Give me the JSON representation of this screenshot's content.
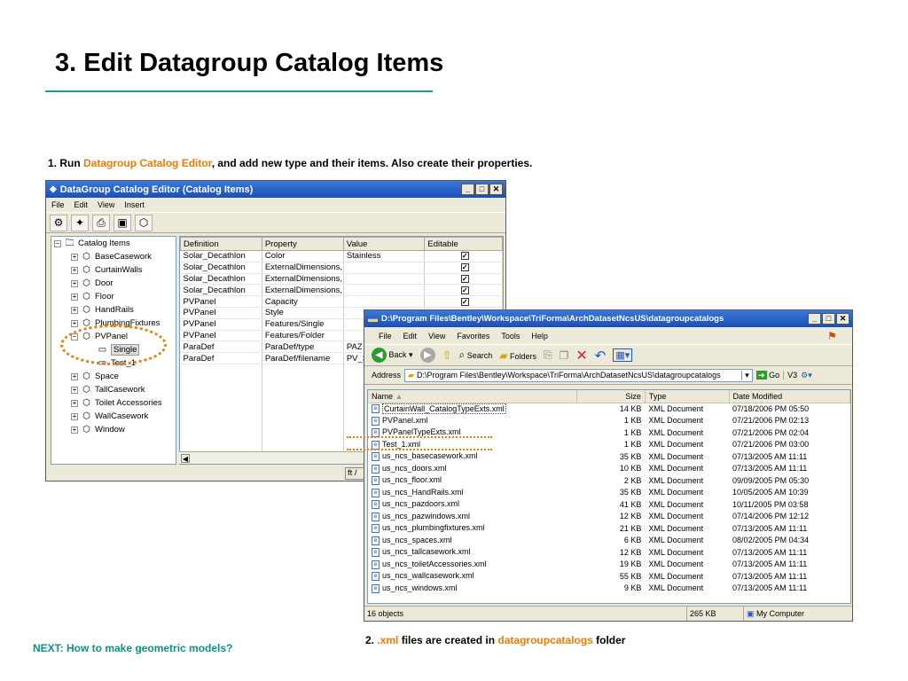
{
  "slide": {
    "title": "3. Edit Datagroup Catalog Items",
    "step1": {
      "prefix": "1. Run ",
      "link": "Datagroup Catalog Editor",
      "suffix": ", and add new type and their items. Also create their properties."
    },
    "step2": {
      "prefix": "2. ",
      "ext": ".xml",
      "middle": " files are created in ",
      "folder": "datagroupcatalogs",
      "suffix": " folder"
    },
    "next": "NEXT: How to make geometric models?"
  },
  "colors": {
    "accent_orange": "#f07b05",
    "accent_teal": "#0f8f8a",
    "rule": "#1a9a96",
    "titlebar": "#2458c8"
  },
  "editor": {
    "title": "DataGroup Catalog Editor (Catalog Items)",
    "menu": [
      "File",
      "Edit",
      "View",
      "Insert"
    ],
    "toolbar_icons": [
      "properties-icon",
      "new-item-icon",
      "print-icon",
      "save-icon",
      "cube-icon"
    ],
    "tree": {
      "root": "Catalog Items",
      "items": [
        "BaseCasework",
        "CurtainWalls",
        "Door",
        "Floor",
        "HandRails",
        "PlumbingFixtures",
        "PVPanel"
      ],
      "children": [
        "Single",
        "Test_1"
      ],
      "items_after": [
        "Space",
        "TallCasework",
        "Toilet Accessories",
        "WallCasework",
        "Window"
      ]
    },
    "grid": {
      "headers": [
        "Definition",
        "Property",
        "Value",
        "Editable"
      ],
      "rows": [
        [
          "Solar_Decathlon",
          "Color",
          "Stainless"
        ],
        [
          "Solar_Decathlon",
          "ExternalDimensions,",
          ""
        ],
        [
          "Solar_Decathlon",
          "ExternalDimensions,",
          ""
        ],
        [
          "Solar_Decathlon",
          "ExternalDimensions,",
          ""
        ],
        [
          "PVPanel",
          "Capacity",
          ""
        ],
        [
          "PVPanel",
          "Style",
          ""
        ],
        [
          "PVPanel",
          "Features/Single",
          ""
        ],
        [
          "PVPanel",
          "Features/Folder",
          ""
        ],
        [
          "ParaDef",
          "ParaDef/type",
          "PAZ"
        ],
        [
          "ParaDef",
          "ParaDef/filename",
          "PV_S"
        ]
      ]
    },
    "status": "ft /"
  },
  "explorer": {
    "title": "D:\\Program Files\\Bentley\\Workspace\\TriForma\\ArchDatasetNcsUS\\datagroupcatalogs",
    "menu": [
      "File",
      "Edit",
      "View",
      "Favorites",
      "Tools",
      "Help"
    ],
    "toolbar": {
      "back": "Back",
      "search": "Search",
      "folders": "Folders"
    },
    "address": {
      "label": "Address",
      "value": "D:\\Program Files\\Bentley\\Workspace\\TriForma\\ArchDatasetNcsUS\\datagroupcatalogs",
      "go": "Go",
      "extra": "V3"
    },
    "columns": [
      "Name",
      "Size",
      "Type",
      "Date Modified"
    ],
    "files": [
      [
        "CurtainWall_CatalogTypeExts.xml",
        "14 KB",
        "XML Document",
        "07/18/2006 PM 05:50"
      ],
      [
        "PVPanel.xml",
        "1 KB",
        "XML Document",
        "07/21/2006 PM 02:13"
      ],
      [
        "PVPanelTypeExts.xml",
        "1 KB",
        "XML Document",
        "07/21/2006 PM 02:04"
      ],
      [
        "Test_1.xml",
        "1 KB",
        "XML Document",
        "07/21/2006 PM 03:00"
      ],
      [
        "us_ncs_basecasework.xml",
        "35 KB",
        "XML Document",
        "07/13/2005 AM 11:11"
      ],
      [
        "us_ncs_doors.xml",
        "10 KB",
        "XML Document",
        "07/13/2005 AM 11:11"
      ],
      [
        "us_ncs_floor.xml",
        "2 KB",
        "XML Document",
        "09/09/2005 PM 05:30"
      ],
      [
        "us_ncs_HandRails.xml",
        "35 KB",
        "XML Document",
        "10/05/2005 AM 10:39"
      ],
      [
        "us_ncs_pazdoors.xml",
        "41 KB",
        "XML Document",
        "10/11/2005 PM 03:58"
      ],
      [
        "us_ncs_pazwindows.xml",
        "12 KB",
        "XML Document",
        "07/14/2006 PM 12:12"
      ],
      [
        "us_ncs_plumbingfixtures.xml",
        "21 KB",
        "XML Document",
        "07/13/2005 AM 11:11"
      ],
      [
        "us_ncs_spaces.xml",
        "6 KB",
        "XML Document",
        "08/02/2005 PM 04:34"
      ],
      [
        "us_ncs_tallcasework.xml",
        "12 KB",
        "XML Document",
        "07/13/2005 AM 11:11"
      ],
      [
        "us_ncs_toiletAccessories.xml",
        "19 KB",
        "XML Document",
        "07/13/2005 AM 11:11"
      ],
      [
        "us_ncs_wallcasework.xml",
        "55 KB",
        "XML Document",
        "07/13/2005 AM 11:11"
      ],
      [
        "us_ncs_windows.xml",
        "9 KB",
        "XML Document",
        "07/13/2005 AM 11:11"
      ]
    ],
    "status": {
      "count": "16 objects",
      "size": "265 KB",
      "zone": "My Computer"
    }
  }
}
